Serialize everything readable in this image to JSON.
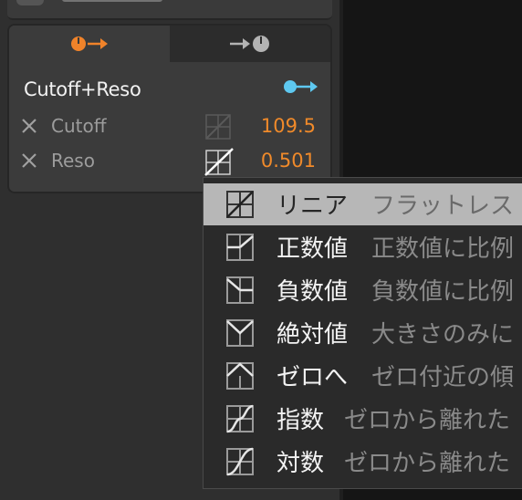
{
  "panel": {
    "tabs": [
      {
        "icon": "knob-out-icon",
        "color": "#f0832a"
      },
      {
        "icon": "knob-in-icon",
        "color": "#b3b3b3"
      }
    ],
    "modulator_title": "Cutoff+Reso",
    "link_icon": "link-arrow-icon",
    "accent": "#5ec8f0",
    "params": [
      {
        "label": "Cutoff",
        "value": "109.5"
      },
      {
        "label": "Reso",
        "value": "0.501"
      }
    ]
  },
  "menu": {
    "items": [
      {
        "name": "リニア",
        "desc": "フラットレス",
        "selected": true,
        "icon": "linear-curve-icon"
      },
      {
        "name": "正数値",
        "desc": "正数値に比例",
        "selected": false,
        "icon": "positive-curve-icon"
      },
      {
        "name": "負数値",
        "desc": "負数値に比例",
        "selected": false,
        "icon": "negative-curve-icon"
      },
      {
        "name": "絶対値",
        "desc": "大きさのみに",
        "selected": false,
        "icon": "absolute-curve-icon"
      },
      {
        "name": "ゼロへ",
        "desc": "ゼロ付近の傾",
        "selected": false,
        "icon": "toward-zero-curve-icon"
      },
      {
        "name": "指数",
        "desc": "ゼロから離れた",
        "selected": false,
        "icon": "exponential-curve-icon"
      },
      {
        "name": "対数",
        "desc": "ゼロから離れた",
        "selected": false,
        "icon": "logarithmic-curve-icon"
      }
    ]
  }
}
